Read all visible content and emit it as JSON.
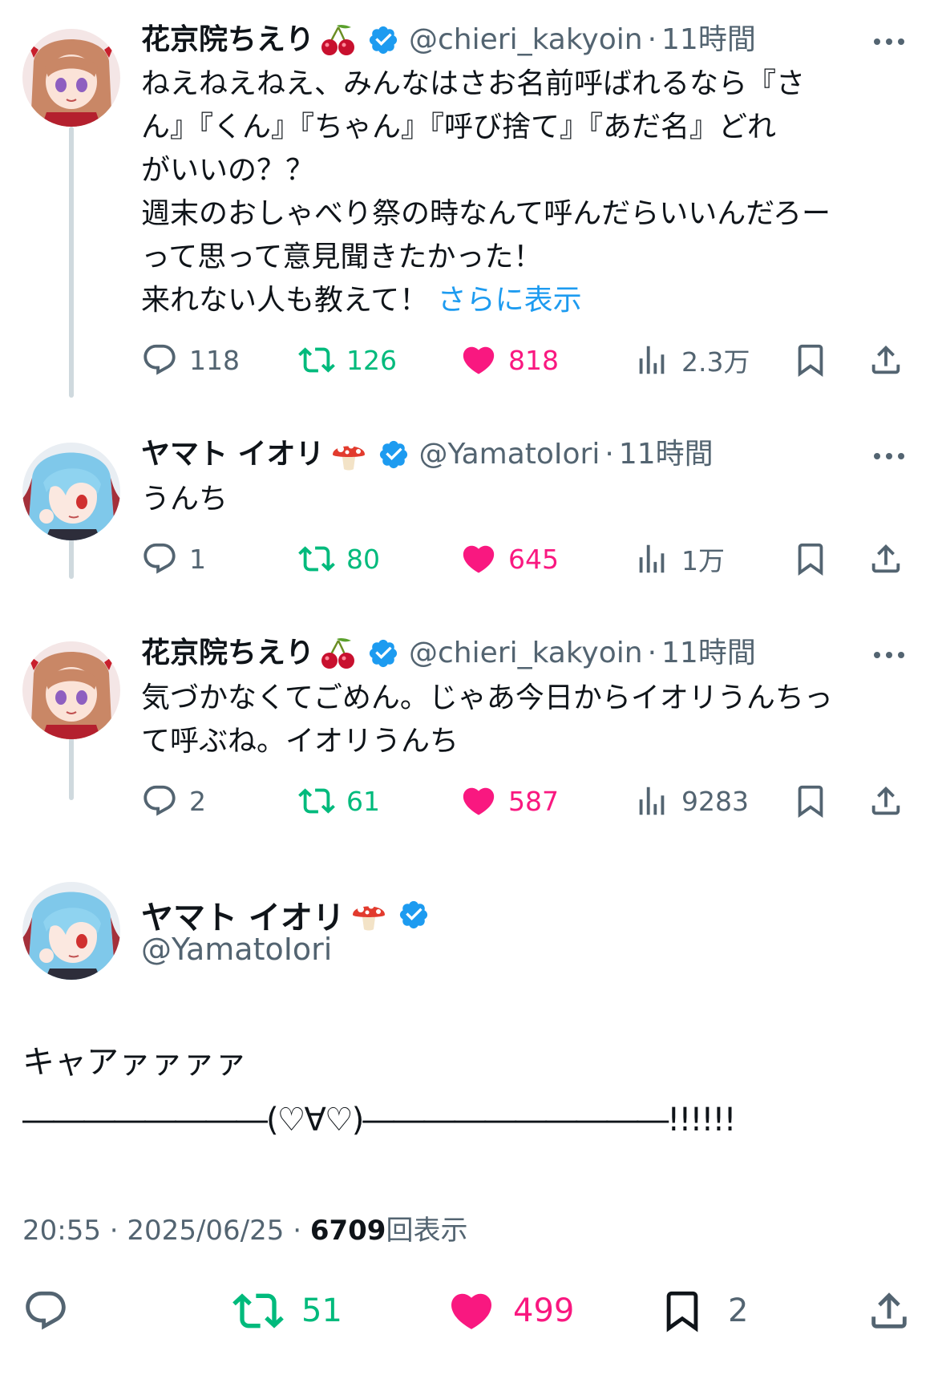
{
  "tweets": [
    {
      "name": "花京院ちえり",
      "emoji": "cherry",
      "handle": "@chieri_kakyoin",
      "dot": "·",
      "time": "11時間",
      "lines": [
        "ねえねえねえ、みんなはさお名前呼ばれるなら『さ",
        "ん』『くん』『ちゃん』『呼び捨て』『あだ名』どれ",
        "がいいの？？",
        "週末のおしゃべり祭の時なんて呼んだらいいんだろー",
        "って思って意見聞きたかった！",
        "来れない人も教えて！"
      ],
      "show_more": "さらに表示",
      "replies": "118",
      "retweets": "126",
      "likes": "818",
      "views": "2.3万"
    },
    {
      "name": "ヤマト イオリ",
      "emoji": "mushroom",
      "handle": "@YamatoIori",
      "dot": "·",
      "time": "11時間",
      "lines": [
        "うんち"
      ],
      "replies": "1",
      "retweets": "80",
      "likes": "645",
      "views": "1万"
    },
    {
      "name": "花京院ちえり",
      "emoji": "cherry",
      "handle": "@chieri_kakyoin",
      "dot": "·",
      "time": "11時間",
      "lines": [
        "気づかなくてごめん。じゃあ今日からイオリうんちっ",
        "て呼ぶね。イオリうんち"
      ],
      "replies": "2",
      "retweets": "61",
      "likes": "587",
      "views": "9283"
    }
  ],
  "main": {
    "name": "ヤマト イオリ",
    "emoji": "mushroom",
    "handle": "@YamatoIori",
    "text_line1": "キャアァァァァ",
    "text_line2": "――――――――(♡∀♡)――――――――――!!!!!!",
    "time": "20:55",
    "dot1": "·",
    "date": "2025/06/25",
    "dot2": "·",
    "views_count": "6709",
    "views_label": "回表示",
    "retweets": "51",
    "likes": "499",
    "bookmarks": "2"
  },
  "colors": {
    "text": "#0f1419",
    "secondary": "#536471",
    "link": "#1d9bf0",
    "retweet": "#00ba7c",
    "like": "#f91880",
    "thread_line": "#cfd9de"
  },
  "icons": [
    "reply-icon",
    "retweet-icon",
    "like-icon",
    "views-icon",
    "bookmark-icon",
    "share-icon",
    "verified-icon",
    "more-icon",
    "cherry-emoji",
    "mushroom-emoji"
  ]
}
